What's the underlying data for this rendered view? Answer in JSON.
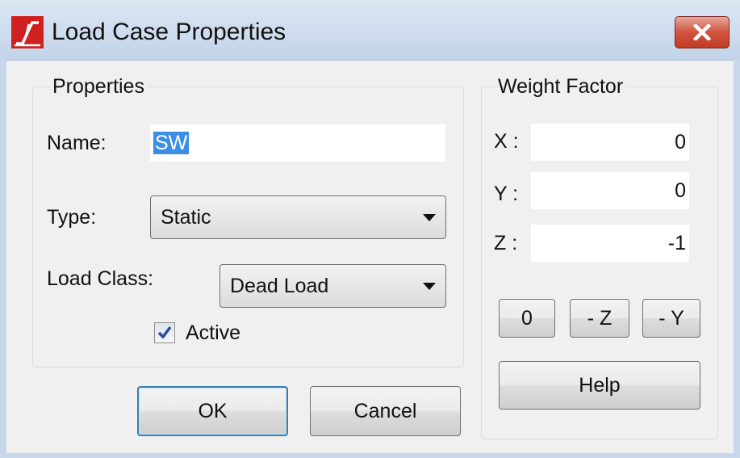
{
  "window": {
    "title": "Load Case Properties",
    "close_icon": "close-x-icon",
    "app_icon": "app-logo-icon"
  },
  "properties": {
    "group_label": "Properties",
    "name_label": "Name:",
    "name_value": "SW",
    "type_label": "Type:",
    "type_value": "Static",
    "load_class_label": "Load Class:",
    "load_class_value": "Dead Load",
    "active_label": "Active",
    "active_checked": true
  },
  "weight_factor": {
    "group_label": "Weight Factor",
    "x_label": "X :",
    "x_value": "0",
    "y_label": "Y :",
    "y_value": "0",
    "z_label": "Z :",
    "z_value": "-1",
    "btn_zero": "0",
    "btn_minus_z": "- Z",
    "btn_minus_y": "- Y"
  },
  "buttons": {
    "ok": "OK",
    "cancel": "Cancel",
    "help": "Help"
  },
  "colors": {
    "accent": "#3c7fb1",
    "selection": "#3a8ee6",
    "close": "#c23a22",
    "logo": "#d02020"
  }
}
